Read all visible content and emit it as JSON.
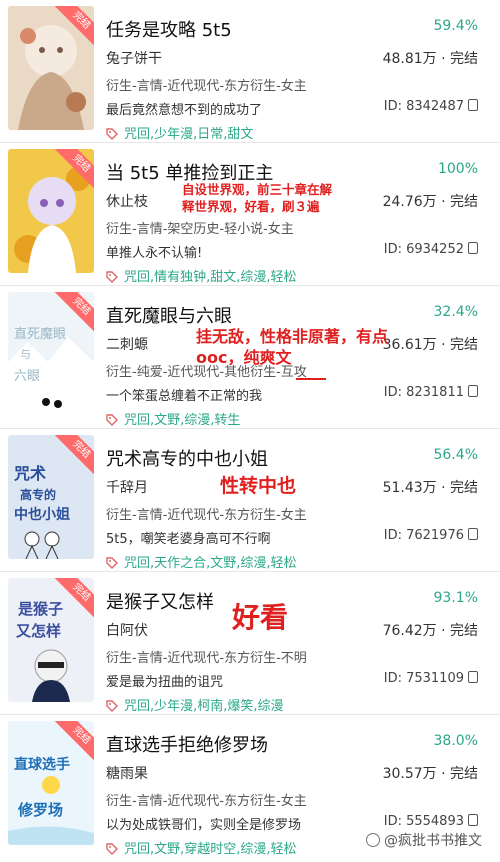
{
  "colors": {
    "accent": "#2aa888",
    "annotation": "#e01f1f",
    "ribbon": "#ff6a6a"
  },
  "ribbon_label": "完结",
  "books": [
    {
      "title": "任务是攻略 5t5",
      "rate": "59.4%",
      "author": "兔子饼干",
      "stats": "48.81万 · 完结",
      "genre": "衍生-言情-近代现代-东方衍生-女主",
      "desc": "最后竟然意想不到的成功了",
      "id": "ID: 8342487",
      "tags": "咒回,少年漫,日常,甜文"
    },
    {
      "title": "当 5t5 单推捡到正主",
      "rate": "100%",
      "author": "休止枝",
      "stats": "24.76万 · 完结",
      "genre": "衍生-言情-架空历史-轻小说-女主",
      "desc": "单推人永不认输!",
      "id": "ID: 6934252",
      "tags": "咒回,情有独钟,甜文,综漫,轻松"
    },
    {
      "title": "直死魔眼与六眼",
      "rate": "32.4%",
      "author": "二刺螈",
      "stats": "36.61万 · 完结",
      "genre": "衍生-纯爱-近代现代-其他衍生-互攻",
      "desc": "一个笨蛋总缠着不正常的我",
      "id": "ID: 8231811",
      "tags": "咒回,文野,综漫,转生"
    },
    {
      "title": "咒术高专的中也小姐",
      "rate": "56.4%",
      "author": "千辞月",
      "stats": "51.43万 · 完结",
      "genre": "衍生-言情-近代现代-东方衍生-女主",
      "desc": "5t5，嘲笑老婆身高可不行啊",
      "id": "ID: 7621976",
      "tags": "咒回,天作之合,文野,综漫,轻松"
    },
    {
      "title": "是猴子又怎样",
      "rate": "93.1%",
      "author": "白阿伏",
      "stats": "76.42万 · 完结",
      "genre": "衍生-言情-近代现代-东方衍生-不明",
      "desc": "爱是最为扭曲的诅咒",
      "id": "ID: 7531109",
      "tags": "咒回,少年漫,柯南,爆笑,综漫"
    },
    {
      "title": "直球选手拒绝修罗场",
      "rate": "38.0%",
      "author": "糖雨果",
      "stats": "30.57万 · 完结",
      "genre": "衍生-言情-近代现代-东方衍生-女主",
      "desc": "以为处成铁哥们，实则全是修罗场",
      "id": "ID: 5554893",
      "tags": "咒回,文野,穿越时空,综漫,轻松"
    }
  ],
  "annotations": {
    "note2_line1": "自设世界观，前三十章在解",
    "note2_line2": "释世界观，好看，刷３遍",
    "note3_line1": "挂无敌，性格非原著，有点",
    "note3_line2": "ooc，纯爽文",
    "note4": "性转中也",
    "note5": "好看"
  },
  "watermark": "@疯批书书推文"
}
